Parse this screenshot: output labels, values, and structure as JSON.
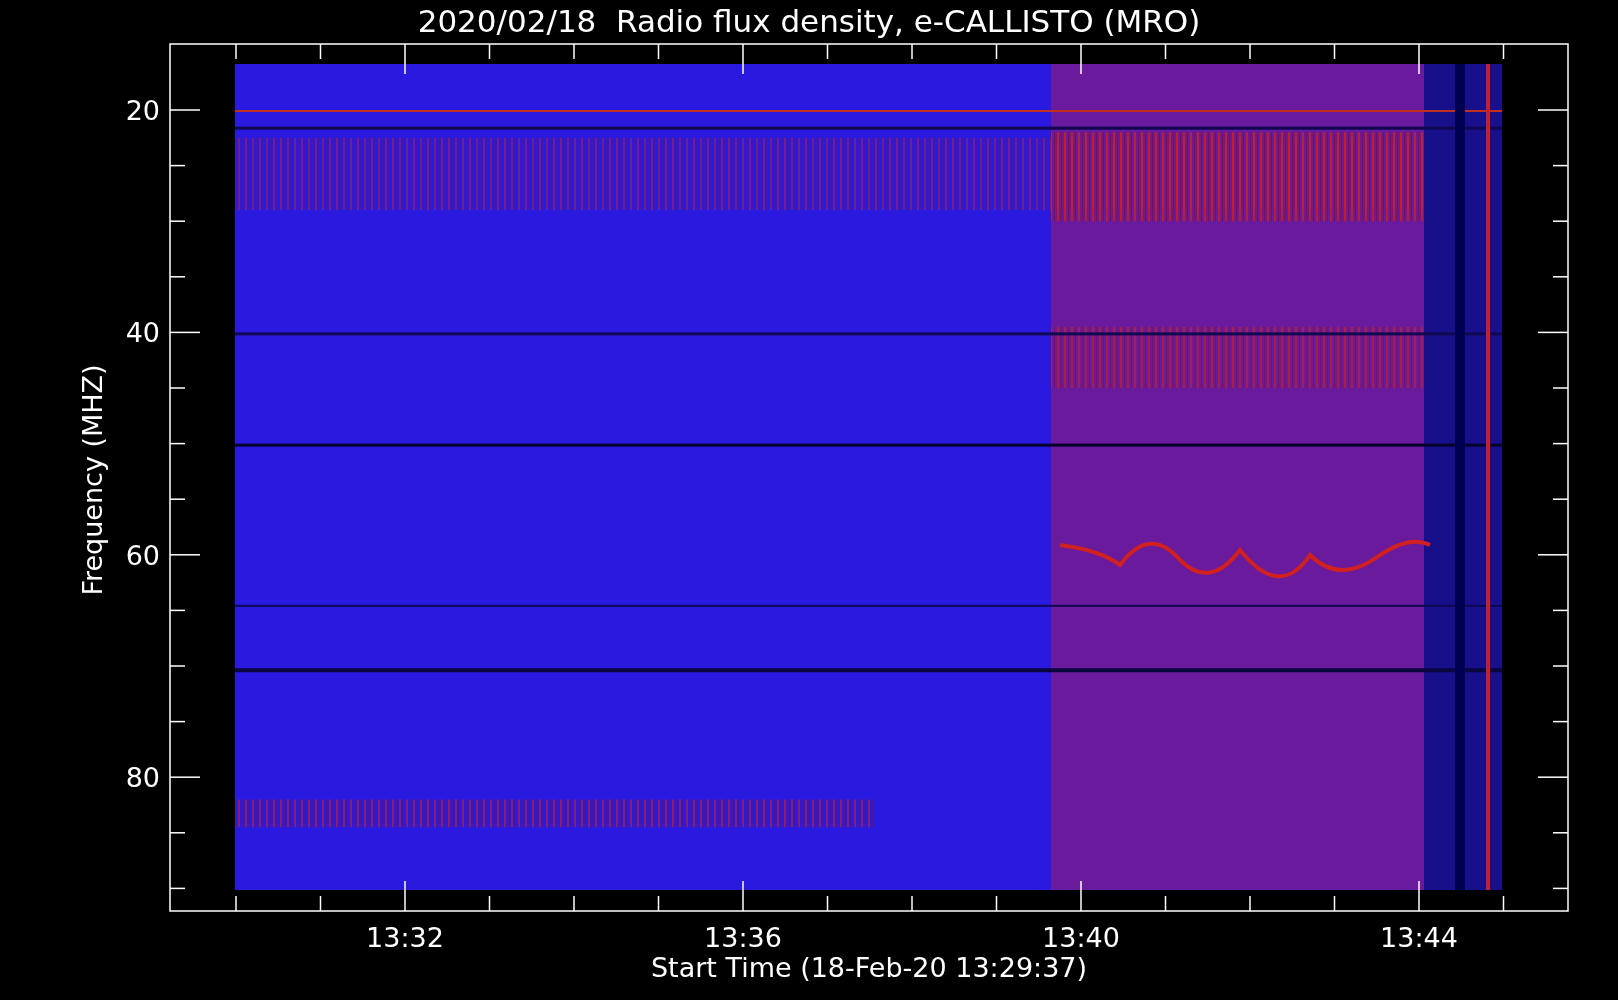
{
  "title": "2020/02/18  Radio flux density, e-CALLISTO (MRO)",
  "y_axis": {
    "label": "Frequency (MHZ)",
    "ticks": [
      "20",
      "40",
      "60",
      "80"
    ]
  },
  "x_axis": {
    "label": "Start Time (18-Feb-20 13:29:37)",
    "ticks": [
      "13:32",
      "13:36",
      "13:40",
      "13:44"
    ]
  }
}
